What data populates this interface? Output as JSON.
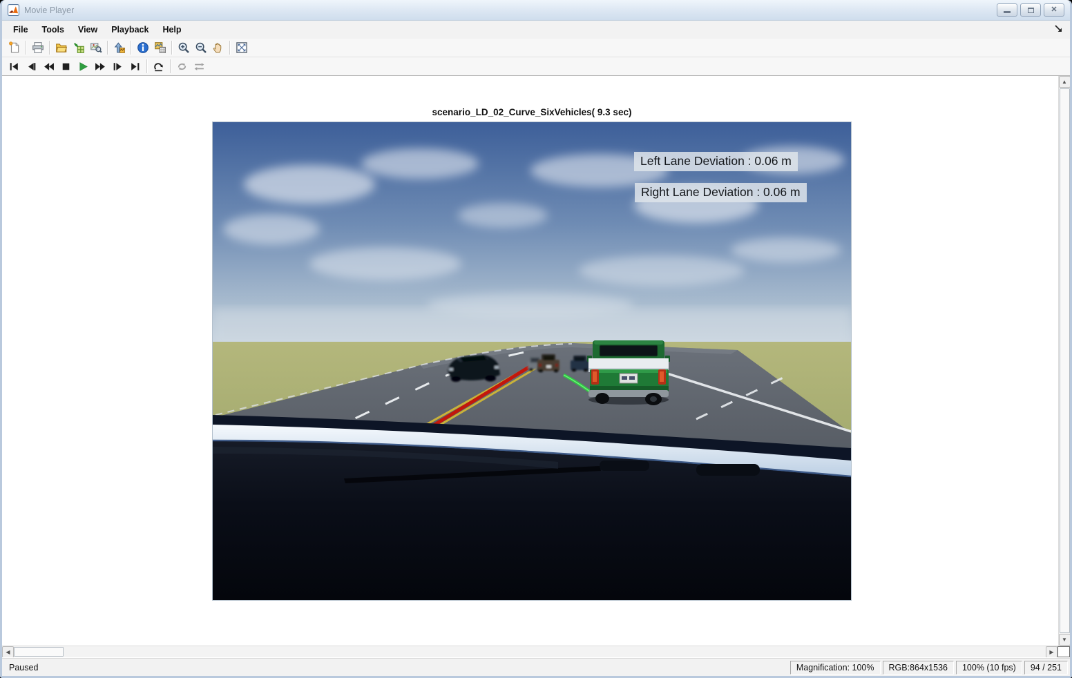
{
  "window": {
    "title": "Movie Player",
    "controls": [
      "minimize",
      "maximize",
      "close"
    ]
  },
  "menu": {
    "items": [
      "File",
      "Tools",
      "View",
      "Playback",
      "Help"
    ]
  },
  "main_toolbar": {
    "icons": [
      "new-file",
      "print",
      "open-file",
      "export-to-workspace",
      "inspect-frame",
      "export-image",
      "info",
      "pixel-region",
      "zoom-in",
      "zoom-out",
      "pan",
      "fit-to-window"
    ]
  },
  "playback_toolbar": {
    "icons": [
      "go-to-first-frame",
      "step-back",
      "rewind",
      "stop",
      "play",
      "fast-forward",
      "step-forward",
      "go-to-last-frame",
      "jump-to-frame",
      "repeat-loop",
      "play-forward-backward"
    ],
    "play_color": "#2f9e40"
  },
  "viewer": {
    "frame_title": "scenario_LD_02_Curve_SixVehicles( 9.3 sec)",
    "overlays": [
      "Left Lane Deviation : 0.06 m",
      "Right Lane Deviation : 0.06 m"
    ],
    "overlay_bg": "#dee4ea"
  },
  "scene": {
    "sky_color": "#3d5f99",
    "grass_color": "#a9ac72",
    "road_color": "#565c64",
    "left_lane_boundary_color": "#c3170b",
    "center_line_color": "#c9b23a",
    "right_lane_boundary_color": "#2ecc40",
    "pickup_color": "#1f7a36"
  },
  "status_bar": {
    "playback_state": "Paused",
    "magnification": "Magnification: 100%",
    "resolution": "RGB:864x1536",
    "rate": "100% (10 fps)",
    "frame_counter": "94 / 251"
  }
}
